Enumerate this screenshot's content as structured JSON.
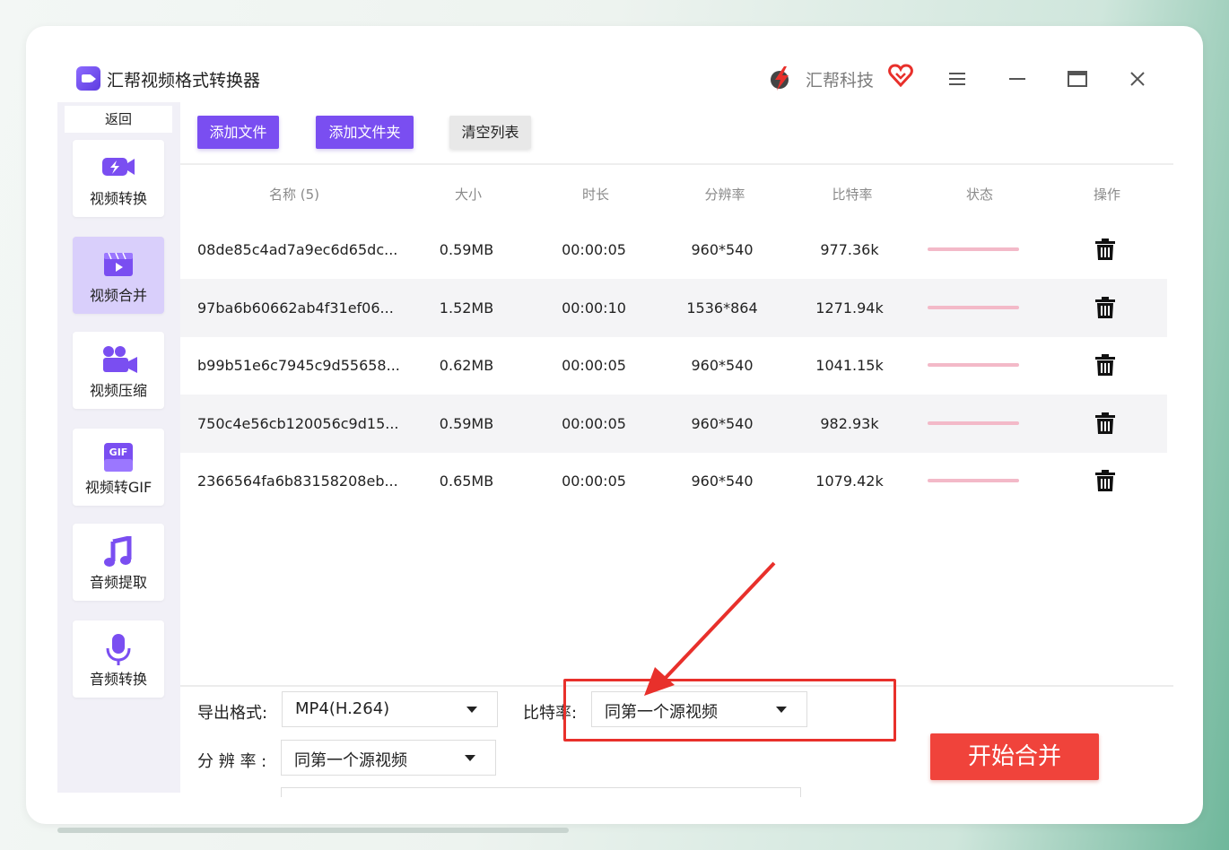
{
  "titlebar": {
    "app_title": "汇帮视频格式转换器",
    "app_icon": "video-camera-icon",
    "brand_name": "汇帮科技",
    "brand_icon": "lightning-logo-icon",
    "heart_icon": "heart-icon",
    "menu_icon": "menu-icon",
    "minimize_icon": "minimize-icon",
    "maximize_icon": "maximize-icon",
    "close_icon": "close-icon"
  },
  "sidebar": {
    "back_label": "返回",
    "items": [
      {
        "label": "视频转换",
        "icon": "video-convert-icon",
        "active": false
      },
      {
        "label": "视频合并",
        "icon": "video-merge-icon",
        "active": true
      },
      {
        "label": "视频压缩",
        "icon": "video-compress-icon",
        "active": false
      },
      {
        "label": "视频转GIF",
        "icon": "gif-icon",
        "active": false
      },
      {
        "label": "音频提取",
        "icon": "music-note-icon",
        "active": false
      },
      {
        "label": "音频转换",
        "icon": "microphone-icon",
        "active": false
      }
    ]
  },
  "toolbar": {
    "add_file": "添加文件",
    "add_folder": "添加文件夹",
    "clear_list": "清空列表"
  },
  "table": {
    "headers": {
      "name": "名称 (5)",
      "size": "大小",
      "duration": "时长",
      "resolution": "分辨率",
      "bitrate": "比特率",
      "status": "状态",
      "action": "操作"
    },
    "rows": [
      {
        "name": "08de85c4ad7a9ec6d65dc...",
        "size": "0.59MB",
        "duration": "00:00:05",
        "resolution": "960*540",
        "bitrate": "977.36k",
        "progress": 0
      },
      {
        "name": "97ba6b60662ab4f31ef06...",
        "size": "1.52MB",
        "duration": "00:00:10",
        "resolution": "1536*864",
        "bitrate": "1271.94k",
        "progress": 0
      },
      {
        "name": "b99b51e6c7945c9d55658...",
        "size": "0.62MB",
        "duration": "00:00:05",
        "resolution": "960*540",
        "bitrate": "1041.15k",
        "progress": 0
      },
      {
        "name": "750c4e56cb120056c9d15...",
        "size": "0.59MB",
        "duration": "00:00:05",
        "resolution": "960*540",
        "bitrate": "982.93k",
        "progress": 0
      },
      {
        "name": "2366564fa6b83158208eb...",
        "size": "0.65MB",
        "duration": "00:00:05",
        "resolution": "960*540",
        "bitrate": "1079.42k",
        "progress": 0
      }
    ],
    "delete_icon": "trash-icon"
  },
  "settings": {
    "export_format_label": "导出格式:",
    "export_format_value": "MP4(H.264)",
    "bitrate_label": "比特率:",
    "bitrate_value": "同第一个源视频",
    "resolution_label": "分 辨 率 :",
    "resolution_value": "同第一个源视频"
  },
  "start_button": "开始合并",
  "colors": {
    "accent_purple": "#7a4ef1",
    "start_red": "#f0433b",
    "highlight_red": "#e8302b",
    "active_nav": "#d9cffb"
  }
}
